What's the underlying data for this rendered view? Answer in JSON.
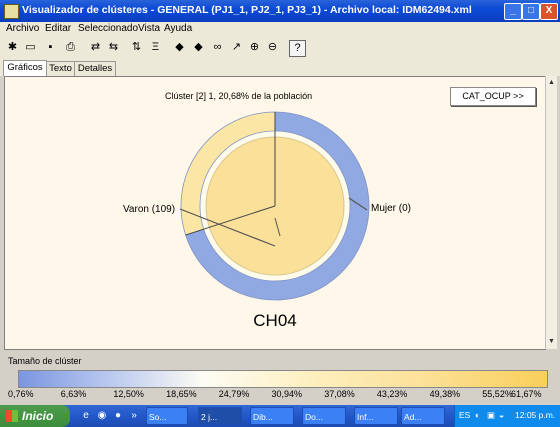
{
  "window": {
    "title": "Visualizador de clústeres - GENERAL (PJ1_1, PJ2_1, PJ3_1) - Archivo local: IDM62494.xml",
    "buttons": [
      "_",
      "□",
      "X"
    ]
  },
  "menu": [
    "Archivo",
    "Editar",
    "Seleccionado",
    "Vista",
    "Ayuda"
  ],
  "toolbar_icons": [
    "new-icon",
    "open-icon",
    "save-icon",
    "print-icon",
    "swap-icon",
    "back-forward-icon",
    "sort-icon",
    "filter-icon",
    "arrow-left-icon",
    "arrow-right-icon",
    "binoculars-icon",
    "pointer-icon",
    "zoom-in-icon",
    "zoom-out-icon",
    "help-icon"
  ],
  "tabs": [
    "Gráficos",
    "Texto",
    "Detalles"
  ],
  "active_tab": 0,
  "chart_header": "Clúster [2] 1, 20,68% de la población",
  "cat_button": "CAT_OCUP >>",
  "chart_data": {
    "type": "pie",
    "title": "CH04",
    "categories": [
      "Varon (109)",
      "Mujer (0)"
    ],
    "outer_ring": {
      "labels": [
        "Varon",
        "Mujer"
      ],
      "values": [
        0.7,
        0.3
      ],
      "colors": [
        "#91a9e3",
        "#fbe6a6"
      ]
    },
    "inner_pie": {
      "labels": [
        "Varon (109)",
        "Mujer (0)"
      ],
      "values": [
        1.0,
        0.0
      ],
      "color": "#fbe09a"
    }
  },
  "legend": {
    "title": "Tamaño de clúster",
    "ticks": [
      "0,76%",
      "6,63%",
      "12,50%",
      "18,65%",
      "24,79%",
      "30,94%",
      "37,08%",
      "43,23%",
      "49,38%",
      "55,52%",
      "61,67%"
    ],
    "colors": [
      "#7b96e0",
      "#fdfcf4",
      "#f9cf5a"
    ]
  },
  "taskbar": {
    "start": "Inicio",
    "tasks": [
      "So...",
      "2 j...",
      "Dib...",
      "Do...",
      "Inf...",
      "Ad..."
    ],
    "tray_lang": "ES",
    "clock": "12:05 p.m."
  }
}
